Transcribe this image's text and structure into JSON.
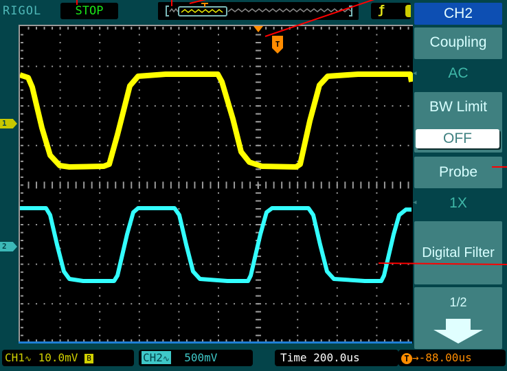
{
  "header": {
    "brand": "RIGOL",
    "run_status": "STOP",
    "trigger_edge_icon": "rising-edge-icon"
  },
  "side_menu": {
    "title": "CH2",
    "items": [
      {
        "label": "Coupling",
        "value": "AC"
      },
      {
        "label": "BW Limit",
        "value": "OFF"
      },
      {
        "label": "Probe",
        "value": "1X"
      },
      {
        "label": "Digital Filter",
        "value": ""
      }
    ],
    "page": "1/2",
    "next_page_icon": "arrow-down-icon"
  },
  "channels": {
    "ch1": {
      "marker": "1",
      "color": "#ffff00"
    },
    "ch2": {
      "marker": "2",
      "color": "#33ffff"
    }
  },
  "status_bar": {
    "ch1_label": "CH1",
    "ch1_coupling": "∿",
    "ch1_scale": "10.0mV",
    "ch1_bw": "B",
    "ch2_label": "CH2",
    "ch2_coupling": "∿",
    "ch2_scale": "500mV",
    "time_label": "Time",
    "time_scale": "200.0us",
    "trigger_marker": "T",
    "trigger_offset": "-88.00us"
  },
  "colors": {
    "ch1": "#ffff00",
    "ch2": "#33ffff",
    "trigger": "#ff8c00",
    "annotation": "#ff0000",
    "menu_title": "#0d4fb3",
    "menu_button": "#3f8080"
  }
}
